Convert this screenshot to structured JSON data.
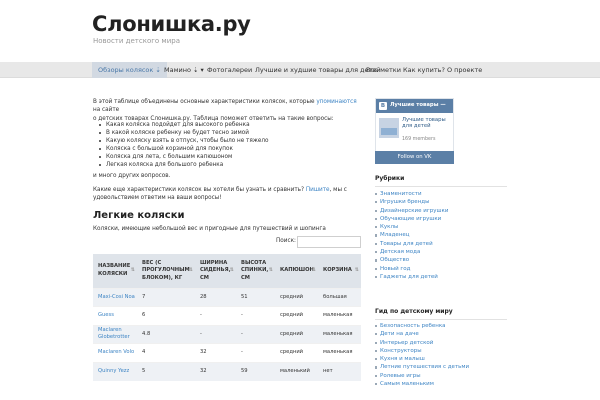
{
  "site": {
    "title": "Слонишка.ру",
    "description": "Новости детского мира"
  },
  "nav": [
    {
      "label": "Обзоры колясок ⇣",
      "active": true
    },
    {
      "label": "Мамино ⇣ ▾",
      "active": false
    },
    {
      "label": "Фотогалереи",
      "active": false
    },
    {
      "label": "Лучшие и худшие товары для детей",
      "active": false
    },
    {
      "label": "Все метки",
      "active": false
    },
    {
      "label": "Как купить?",
      "active": false
    },
    {
      "label": "О проекте",
      "active": false
    }
  ],
  "intro": {
    "before_link": "В этой таблице объединены основные характеристики колясок, которые ",
    "link": "упоминаются",
    "after_link_1": " на сайте",
    "line2": "о детских товарах Слонишка.ру. Таблица поможет ответить на такие вопросы:"
  },
  "questions": [
    "Какая коляска подойдет для высокого ребенка",
    "В какой коляске ребенку не будет тесно зимой",
    "Какую коляску взять в отпуск, чтобы было не тяжело",
    "Коляска с большой корзиной для покупок",
    "Коляска для лета, с большим капюшоном",
    "Легкая коляска для большого ребенка"
  ],
  "more": "и много других вопросов.",
  "ask": {
    "before_link": "Какие еще характеристики колясок вы хотели бы узнать и сравнить? ",
    "link": "Пишите",
    "after_link": ", мы с",
    "line2": "удовольствием ответим на ваши вопросы!"
  },
  "section": {
    "title": "Легкие коляски",
    "subtitle": "Коляски, имеющие небольшой вес и пригодные для путешествий и шопинга"
  },
  "search": {
    "label": "Поиск:",
    "value": ""
  },
  "table": {
    "headers": [
      "НАЗВАНИЕ КОЛЯСКИ",
      "ВЕС (С ПРОГУЛОЧНЫМ БЛОКОМ), КГ",
      "ШИРИНА СИДЕНЬЯ, СМ",
      "ВЫСОТА СПИНКИ, СМ",
      "КАПЮШОН",
      "КОРЗИНА"
    ],
    "rows": [
      [
        "Maxi-Cosi Noa",
        "7",
        "28",
        "51",
        "средний",
        "большая"
      ],
      [
        "Guess",
        "6",
        "-",
        "-",
        "средний",
        "маленькая"
      ],
      [
        "Maclaren Globetrotter",
        "4.8",
        "-",
        "-",
        "средний",
        "маленькая"
      ],
      [
        "Maclaren Volo",
        "4",
        "32",
        "-",
        "средний",
        "маленькая"
      ],
      [
        "Quinny Yezz",
        "5",
        "32",
        "59",
        "маленький",
        "нет"
      ]
    ]
  },
  "vk": {
    "header": "Лучшие товары —",
    "group_name": "Лучшие товары для детей",
    "members": "169 members",
    "follow": "Follow on VK"
  },
  "rubrics": {
    "title": "Рубрики",
    "items": [
      "Знаменитости",
      "Игрушки бренды",
      "Дизайнерские игрушки",
      "Обучающие игрушки",
      "Куклы",
      "Младенец",
      "Товары для детей",
      "Детская мода",
      "Общество",
      "Новый год",
      "Гаджеты для детей"
    ]
  },
  "guide": {
    "title": "Гид по детскому миру",
    "items": [
      "Безопасность ребенка",
      "Дети на даче",
      "Интерьер детской",
      "Конструкторы",
      "Кухня и малыш",
      "Летние путешествия с детьми",
      "Ролевые игры",
      "Самым маленьким"
    ]
  },
  "colors": {
    "link": "#3d84c4",
    "nav_bg": "#e8e8e8",
    "nav_active_bg": "#d2d9e2",
    "table_header_bg": "#dfe4ea",
    "table_odd_row": "#eef1f5",
    "vk_blue": "#5b7fa6"
  }
}
